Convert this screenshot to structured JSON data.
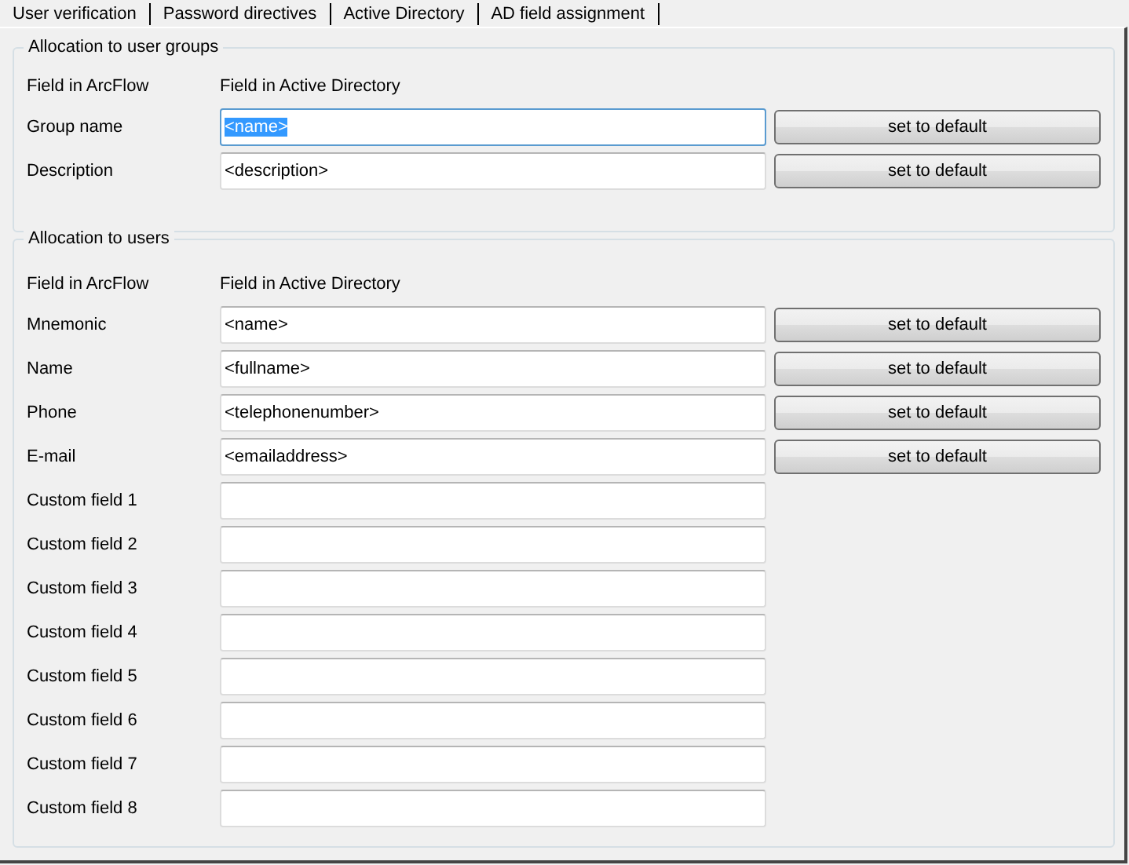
{
  "tabs": [
    {
      "label": "User verification"
    },
    {
      "label": "Password directives"
    },
    {
      "label": "Active Directory"
    },
    {
      "label": "AD field assignment"
    }
  ],
  "groups": [
    {
      "title": "Allocation to user groups",
      "header": [
        "Field in ArcFlow",
        "Field in Active Directory"
      ],
      "rows": [
        {
          "label": "Group name",
          "value": "<name>",
          "focused": true,
          "button": "set to default"
        },
        {
          "label": "Description",
          "value": "<description>",
          "focused": false,
          "button": "set to default"
        }
      ]
    },
    {
      "title": "Allocation to users",
      "header": [
        "Field in ArcFlow",
        "Field in Active Directory"
      ],
      "rows": [
        {
          "label": "Mnemonic",
          "value": "<name>",
          "focused": false,
          "button": "set to default"
        },
        {
          "label": "Name",
          "value": "<fullname>",
          "focused": false,
          "button": "set to default"
        },
        {
          "label": "Phone",
          "value": "<telephonenumber>",
          "focused": false,
          "button": "set to default"
        },
        {
          "label": "E-mail",
          "value": "<emailaddress>",
          "focused": false,
          "button": "set to default"
        },
        {
          "label": "Custom field 1",
          "focused": false
        },
        {
          "label": "Custom field 2",
          "focused": false
        },
        {
          "label": "Custom field 3",
          "focused": false
        },
        {
          "label": "Custom field 4",
          "focused": false
        },
        {
          "label": "Custom field 5",
          "focused": false
        },
        {
          "label": "Custom field 6",
          "focused": false
        },
        {
          "label": "Custom field 7",
          "focused": false
        },
        {
          "label": "Custom field 8",
          "focused": false
        }
      ]
    }
  ]
}
